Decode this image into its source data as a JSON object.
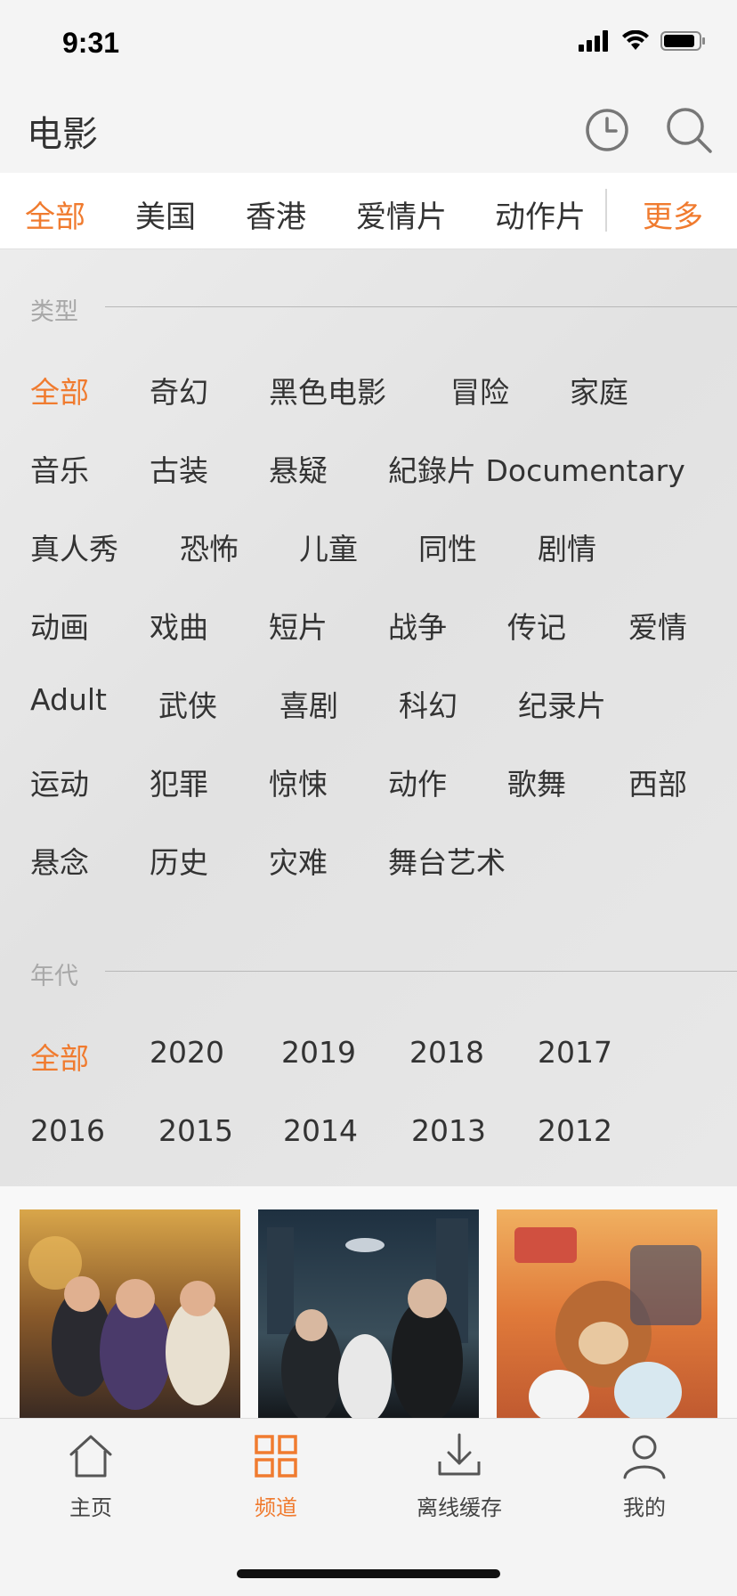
{
  "status_bar": {
    "time": "9:31"
  },
  "header": {
    "title": "电影"
  },
  "tabs": [
    {
      "label": "全部",
      "active": true
    },
    {
      "label": "美国",
      "active": false
    },
    {
      "label": "香港",
      "active": false
    },
    {
      "label": "爱情片",
      "active": false
    },
    {
      "label": "动作片",
      "active": false
    }
  ],
  "more_label": "更多",
  "genre_section": {
    "title": "类型",
    "rows": [
      [
        "全部",
        "奇幻",
        "黑色电影",
        "冒险",
        "家庭"
      ],
      [
        "音乐",
        "古装",
        "悬疑",
        "紀錄片 Documentary"
      ],
      [
        "真人秀",
        "恐怖",
        "儿童",
        "同性",
        "剧情"
      ],
      [
        "动画",
        "戏曲",
        "短片",
        "战争",
        "传记",
        "爱情"
      ],
      [
        "Adult",
        "武侠",
        "喜剧",
        "科幻",
        "纪录片"
      ],
      [
        "运动",
        "犯罪",
        "惊悚",
        "动作",
        "歌舞",
        "西部"
      ],
      [
        "悬念",
        "历史",
        "灾难",
        "舞台艺术"
      ]
    ],
    "active": "全部"
  },
  "year_section": {
    "title": "年代",
    "rows": [
      [
        "全部",
        "2020",
        "2019",
        "2018",
        "2017"
      ],
      [
        "2016",
        "2015",
        "2014",
        "2013",
        "2012"
      ]
    ],
    "active": "全部"
  },
  "bottom_tabs": [
    {
      "label": "主页",
      "icon": "home-icon",
      "active": false
    },
    {
      "label": "频道",
      "icon": "grid-icon",
      "active": true
    },
    {
      "label": "离线缓存",
      "icon": "download-icon",
      "active": false
    },
    {
      "label": "我的",
      "icon": "user-icon",
      "active": false
    }
  ],
  "colors": {
    "accent": "#f07b2f",
    "text": "#333333",
    "muted": "#a8a8a8"
  }
}
